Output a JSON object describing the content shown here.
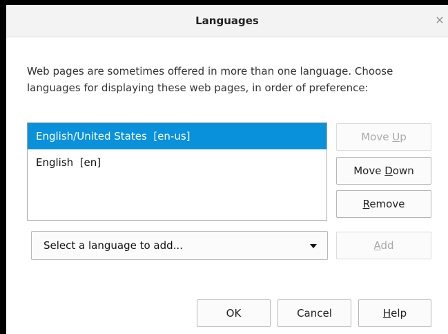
{
  "dialog": {
    "title": "Languages",
    "close_glyph": "×",
    "description": "Web pages are sometimes offered in more than one language. Choose languages for displaying these web pages, in order of preference:"
  },
  "languages": [
    {
      "label": "English/United States  [en-us]",
      "selected": true
    },
    {
      "label": "English  [en]",
      "selected": false
    }
  ],
  "buttons": {
    "move_up": {
      "pre": "Move ",
      "key": "U",
      "post": "p",
      "enabled": false
    },
    "move_down": {
      "pre": "Move ",
      "key": "D",
      "post": "own",
      "enabled": true
    },
    "remove": {
      "pre": "",
      "key": "R",
      "post": "emove",
      "enabled": true
    },
    "add": {
      "pre": "",
      "key": "A",
      "post": "dd",
      "enabled": false
    },
    "ok": {
      "label": "OK"
    },
    "cancel": {
      "label": "Cancel"
    },
    "help": {
      "pre": "",
      "key": "H",
      "post": "elp"
    }
  },
  "select": {
    "value": "Select a language to add..."
  },
  "colors": {
    "selection": "#0a91dc",
    "disabled_text": "#a9a9a9"
  }
}
